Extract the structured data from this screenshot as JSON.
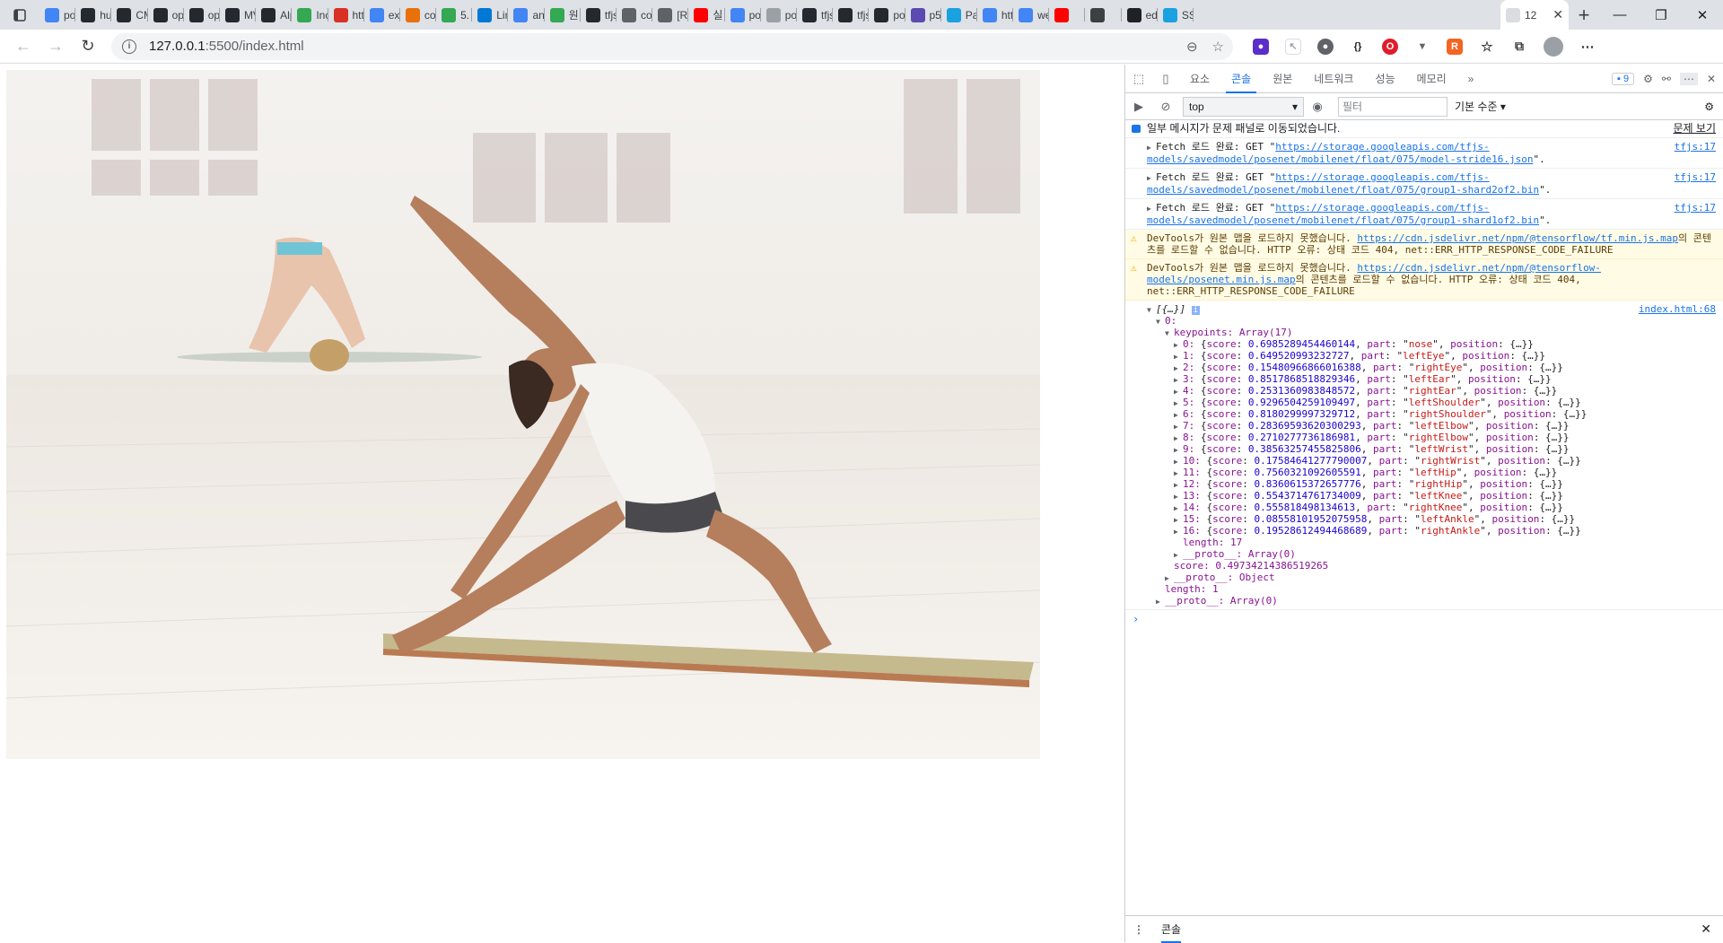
{
  "tabs": [
    {
      "label": "po",
      "icon": "google-icon",
      "color": "#4285f4"
    },
    {
      "label": "hu",
      "icon": "github-icon",
      "color": "#24292f"
    },
    {
      "label": "CM",
      "icon": "github-icon",
      "color": "#24292f"
    },
    {
      "label": "op",
      "icon": "github-icon",
      "color": "#24292f"
    },
    {
      "label": "op",
      "icon": "github-icon",
      "color": "#24292f"
    },
    {
      "label": "MV",
      "icon": "github-icon",
      "color": "#24292f"
    },
    {
      "label": "Alp",
      "icon": "github-icon",
      "color": "#24292f"
    },
    {
      "label": "Inc",
      "icon": "circle-icon",
      "color": "#34a853"
    },
    {
      "label": "htt",
      "icon": "page-icon",
      "color": "#d93025"
    },
    {
      "label": "exp",
      "icon": "google-icon",
      "color": "#4285f4"
    },
    {
      "label": "co",
      "icon": "app-icon",
      "color": "#e8710a"
    },
    {
      "label": "5.",
      "icon": "app-icon",
      "color": "#34a853"
    },
    {
      "label": "Lin",
      "icon": "windows-icon",
      "color": "#0078d4"
    },
    {
      "label": "an",
      "icon": "google-icon",
      "color": "#4285f4"
    },
    {
      "label": "원",
      "icon": "circle-icon",
      "color": "#34a853"
    },
    {
      "label": "tfjs",
      "icon": "github-icon",
      "color": "#24292f"
    },
    {
      "label": "co",
      "icon": "app-icon",
      "color": "#5f6368"
    },
    {
      "label": "[R",
      "icon": "circle-icon",
      "color": "#5f6368"
    },
    {
      "label": "실",
      "icon": "youtube-icon",
      "color": "#ff0000"
    },
    {
      "label": "po",
      "icon": "google-icon",
      "color": "#4285f4"
    },
    {
      "label": "po",
      "icon": "page-icon",
      "color": "#9aa0a6"
    },
    {
      "label": "tfjs",
      "icon": "github-icon",
      "color": "#24292f"
    },
    {
      "label": "tfjs",
      "icon": "github-icon",
      "color": "#24292f"
    },
    {
      "label": "po",
      "icon": "github-icon",
      "color": "#24292f"
    },
    {
      "label": "p5",
      "icon": "app-icon",
      "color": "#5c4ab0"
    },
    {
      "label": "Pa",
      "icon": "app-icon",
      "color": "#1aa1e0"
    },
    {
      "label": "htt",
      "icon": "google-icon",
      "color": "#4285f4"
    },
    {
      "label": "we",
      "icon": "google-icon",
      "color": "#4285f4"
    },
    {
      "label": "",
      "icon": "youtube-icon",
      "color": "#ff0000"
    },
    {
      "label": "",
      "icon": "app-icon",
      "color": "#3c4043"
    },
    {
      "label": "ed",
      "icon": "app-icon",
      "color": "#202124"
    },
    {
      "label": "SS",
      "icon": "app-icon",
      "color": "#1aa1e0"
    }
  ],
  "active_tab": {
    "label": "12"
  },
  "toolbar": {
    "url_host": "127.0.0.1",
    "url_path": ":5500/index.html"
  },
  "devtools": {
    "tabs": [
      "요소",
      "콘솔",
      "원본",
      "네트워크",
      "성능",
      "메모리"
    ],
    "selected_tab": "콘솔",
    "more": "»",
    "issues_count": "9",
    "context": "top",
    "filter_placeholder": "필터",
    "levels": "기본 수준",
    "issues_note": "일부 메시지가 문제 패널로 이동되었습니다.",
    "issues_link": "문제 보기",
    "fetch_messages": [
      {
        "prefix": "Fetch 로드 완료: GET \"",
        "url": "https://storage.googleapis.com/tfjs-models/savedmodel/posenet/mobilenet/float/075/model-stride16.json",
        "suffix": "\".",
        "src": "tfjs:17"
      },
      {
        "prefix": "Fetch 로드 완료: GET \"",
        "url": "https://storage.googleapis.com/tfjs-models/savedmodel/posenet/mobilenet/float/075/group1-shard2of2.bin",
        "suffix": "\".",
        "src": "tfjs:17"
      },
      {
        "prefix": "Fetch 로드 완료: GET \"",
        "url": "https://storage.googleapis.com/tfjs-models/savedmodel/posenet/mobilenet/float/075/group1-shard1of2.bin",
        "suffix": "\".",
        "src": "tfjs:17"
      }
    ],
    "warnings": [
      {
        "prefix": "DevTools가 원본 맵을 로드하지 못했습니다. ",
        "url": "https://cdn.jsdelivr.net/npm/@tensorflow/tf.min.js.map",
        "suffix": "의 콘텐츠를 로드할 수 없습니다. HTTP 오류: 상태 코드 404, net::ERR_HTTP_RESPONSE_CODE_FAILURE"
      },
      {
        "prefix": "DevTools가 원본 맵을 로드하지 못했습니다. ",
        "url": "https://cdn.jsdelivr.net/npm/@tensorflow-models/posenet.min.js.map",
        "suffix": "의 콘텐츠를 로드할 수 없습니다. HTTP 오류: 상태 코드 404, net::ERR_HTTP_RESPONSE_CODE_FAILURE"
      }
    ],
    "log_src": "index.html:68",
    "log_summary": "[{…}]",
    "tree_index": "0:",
    "keypoints_label": "keypoints: Array(17)",
    "keypoints": [
      {
        "score": "0.6985289454460144",
        "part": "nose"
      },
      {
        "score": "0.649520993232727",
        "part": "leftEye"
      },
      {
        "score": "0.15480966866016388",
        "part": "rightEye"
      },
      {
        "score": "0.8517868518829346",
        "part": "leftEar"
      },
      {
        "score": "0.2531360983848572",
        "part": "rightEar"
      },
      {
        "score": "0.9296504259109497",
        "part": "leftShoulder"
      },
      {
        "score": "0.8180299997329712",
        "part": "rightShoulder"
      },
      {
        "score": "0.28369593620300293",
        "part": "leftElbow"
      },
      {
        "score": "0.2710277736186981",
        "part": "rightElbow"
      },
      {
        "score": "0.38563257455825806",
        "part": "leftWrist"
      },
      {
        "score": "0.17584641277790007",
        "part": "rightWrist"
      },
      {
        "score": "0.7560321092605591",
        "part": "leftHip"
      },
      {
        "score": "0.8360615372657776",
        "part": "rightHip"
      },
      {
        "score": "0.5543714761734009",
        "part": "leftKnee"
      },
      {
        "score": "0.555818498134613",
        "part": "rightKnee"
      },
      {
        "score": "0.08558101952075958",
        "part": "leftAnkle"
      },
      {
        "score": "0.19528612494468689",
        "part": "rightAnkle"
      }
    ],
    "length_line": "length: 17",
    "proto_array_line": "__proto__: Array(0)",
    "score_line": "score: 0.49734214386519265",
    "proto_object_line": "__proto__: Object",
    "outer_length_line": "length: 1",
    "outer_proto_line": "__proto__: Array(0)",
    "drawer_tab": "콘솔"
  }
}
